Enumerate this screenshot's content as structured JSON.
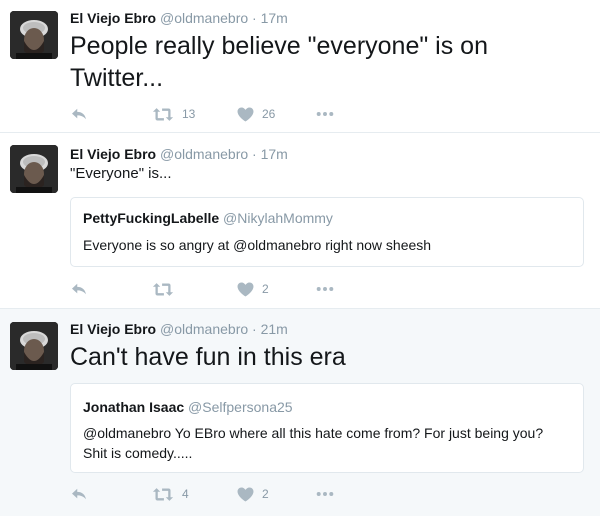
{
  "tweets": [
    {
      "author": "El Viejo Ebro",
      "handle": "@oldmanebro",
      "separator": "·",
      "time": "17m",
      "text_line1": "People really believe \"everyone\" is on",
      "text_line2": "Twitter...",
      "retweets": "13",
      "likes": "26"
    },
    {
      "author": "El Viejo Ebro",
      "handle": "@oldmanebro",
      "separator": "·",
      "time": "17m",
      "text": "\"Everyone\" is...",
      "quote": {
        "author": "PettyFuckingLabelle",
        "handle": "@NikylahMommy",
        "text": "Everyone is so angry at @oldmanebro right now sheesh"
      },
      "retweets": "",
      "likes": "2"
    },
    {
      "author": "El Viejo Ebro",
      "handle": "@oldmanebro",
      "separator": "·",
      "time": "21m",
      "text": "Can't have fun in this era",
      "quote": {
        "author": "Jonathan Isaac",
        "handle": "@Selfpersona25",
        "text_line1": "@oldmanebro Yo EBro where all this hate come from? For just being you?",
        "text_line2": "Shit is comedy....."
      },
      "retweets": "4",
      "likes": "2"
    }
  ],
  "icons": {
    "reply": "reply-arrow-icon",
    "retweet": "retweet-icon",
    "like": "heart-icon",
    "more": "more-dots-icon"
  },
  "colors": {
    "text": "#14171a",
    "secondary": "#8899a6",
    "icon": "#aab8c2",
    "border": "#e6ecf0",
    "highlight_bg": "#f5f8fa"
  }
}
